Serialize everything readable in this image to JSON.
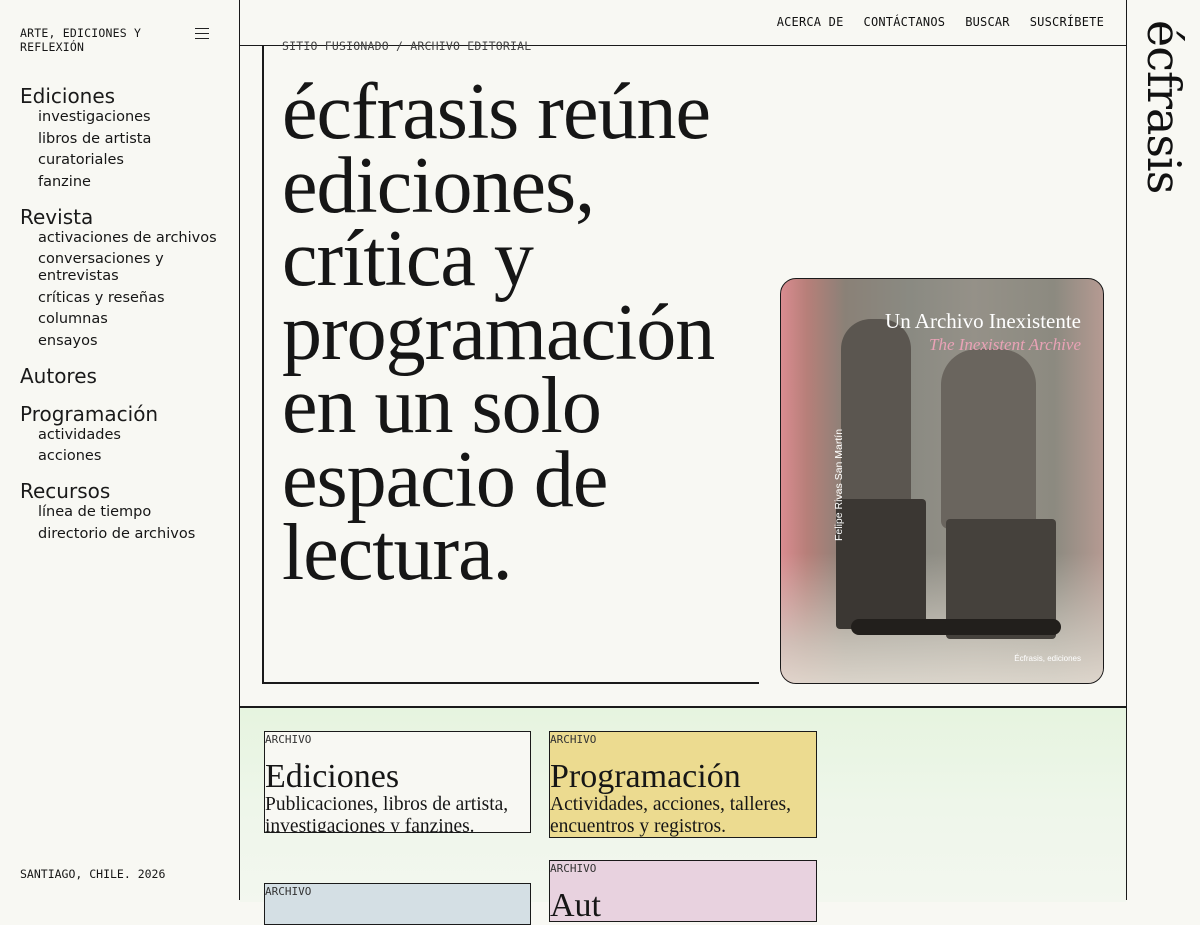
{
  "sidebar": {
    "tagline": "ARTE, EDICIONES Y REFLEXIÓN",
    "footer": "SANTIAGO, CHILE. 2026",
    "sections": [
      {
        "label": "Ediciones",
        "items": [
          "investigaciones",
          "libros de artista",
          "curatoriales",
          "fanzine"
        ]
      },
      {
        "label": "Revista",
        "items": [
          "activaciones de archivos",
          "conversaciones y entrevistas",
          "críticas y reseñas",
          "columnas",
          "ensayos"
        ]
      },
      {
        "label": "Autores",
        "items": []
      },
      {
        "label": "Programación",
        "items": [
          "actividades",
          "acciones"
        ]
      },
      {
        "label": "Recursos",
        "items": [
          "línea de tiempo",
          "directorio de archivos"
        ]
      }
    ]
  },
  "topnav": {
    "items": [
      "ACERCA DE",
      "CONTÁCTANOS",
      "BUSCAR",
      "SUSCRÍBETE"
    ]
  },
  "logo": "écfrasis",
  "hero": {
    "kicker": "SITIO FUSIONADO / ARCHIVO EDITORIAL",
    "headline": "écfrasis reúne ediciones, crítica y programación en un solo espacio de lectura."
  },
  "book": {
    "title": "Un Archivo Inexistente",
    "subtitle": "The Inexistent Archive",
    "author": "Felipe Rivas San Martín",
    "imprint": "Écfrasis, ediciones"
  },
  "cards": [
    {
      "label": "ARCHIVO",
      "title": "Ediciones",
      "desc": "Publicaciones, libros de artista, investigaciones y fanzines.",
      "color": "#f8f8f3"
    },
    {
      "label": "ARCHIVO",
      "title": "Programación",
      "desc": "Actividades, acciones, talleres, encuentros y registros.",
      "color": "#ecdb90"
    },
    {
      "label": "ARCHIVO",
      "title": "",
      "desc": "",
      "color": "#d4dfe4"
    },
    {
      "label": "ARCHIVO",
      "title": "Aut",
      "desc": "",
      "color": "#e8d2df"
    }
  ]
}
